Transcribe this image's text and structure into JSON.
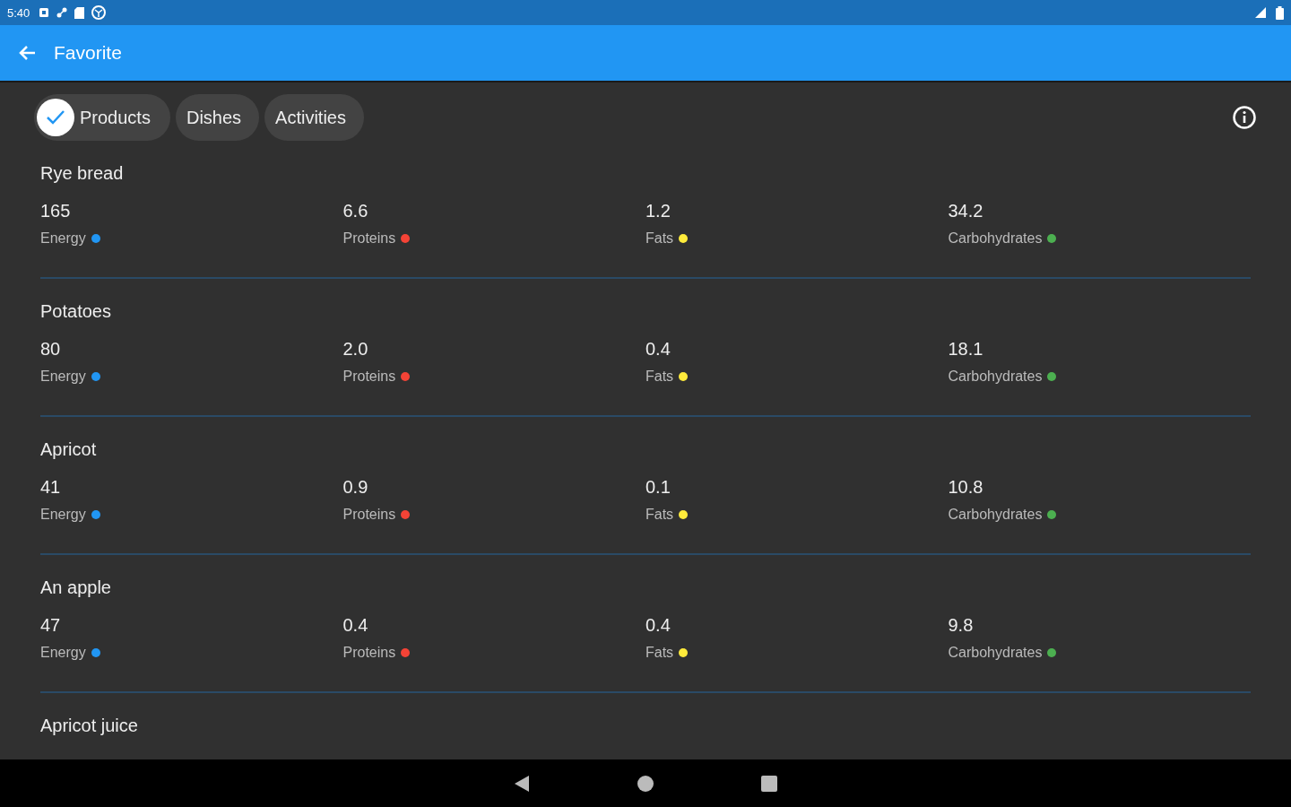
{
  "status_bar": {
    "time": "5:40"
  },
  "app_bar": {
    "title": "Favorite"
  },
  "chips": [
    {
      "label": "Products",
      "selected": true
    },
    {
      "label": "Dishes",
      "selected": false
    },
    {
      "label": "Activities",
      "selected": false
    }
  ],
  "products": [
    {
      "name": "Rye bread",
      "nutrients": [
        {
          "value": "165",
          "label": "Energy",
          "color": "#2196f3"
        },
        {
          "value": "6.6",
          "label": "Proteins",
          "color": "#f44336"
        },
        {
          "value": "1.2",
          "label": "Fats",
          "color": "#ffeb3b"
        },
        {
          "value": "34.2",
          "label": "Carbohydrates",
          "color": "#4caf50"
        }
      ]
    },
    {
      "name": "Potatoes",
      "nutrients": [
        {
          "value": "80",
          "label": "Energy",
          "color": "#2196f3"
        },
        {
          "value": "2.0",
          "label": "Proteins",
          "color": "#f44336"
        },
        {
          "value": "0.4",
          "label": "Fats",
          "color": "#ffeb3b"
        },
        {
          "value": "18.1",
          "label": "Carbohydrates",
          "color": "#4caf50"
        }
      ]
    },
    {
      "name": "Apricot",
      "nutrients": [
        {
          "value": "41",
          "label": "Energy",
          "color": "#2196f3"
        },
        {
          "value": "0.9",
          "label": "Proteins",
          "color": "#f44336"
        },
        {
          "value": "0.1",
          "label": "Fats",
          "color": "#ffeb3b"
        },
        {
          "value": "10.8",
          "label": "Carbohydrates",
          "color": "#4caf50"
        }
      ]
    },
    {
      "name": "An apple",
      "nutrients": [
        {
          "value": "47",
          "label": "Energy",
          "color": "#2196f3"
        },
        {
          "value": "0.4",
          "label": "Proteins",
          "color": "#f44336"
        },
        {
          "value": "0.4",
          "label": "Fats",
          "color": "#ffeb3b"
        },
        {
          "value": "9.8",
          "label": "Carbohydrates",
          "color": "#4caf50"
        }
      ]
    },
    {
      "name": "Apricot juice"
    }
  ]
}
